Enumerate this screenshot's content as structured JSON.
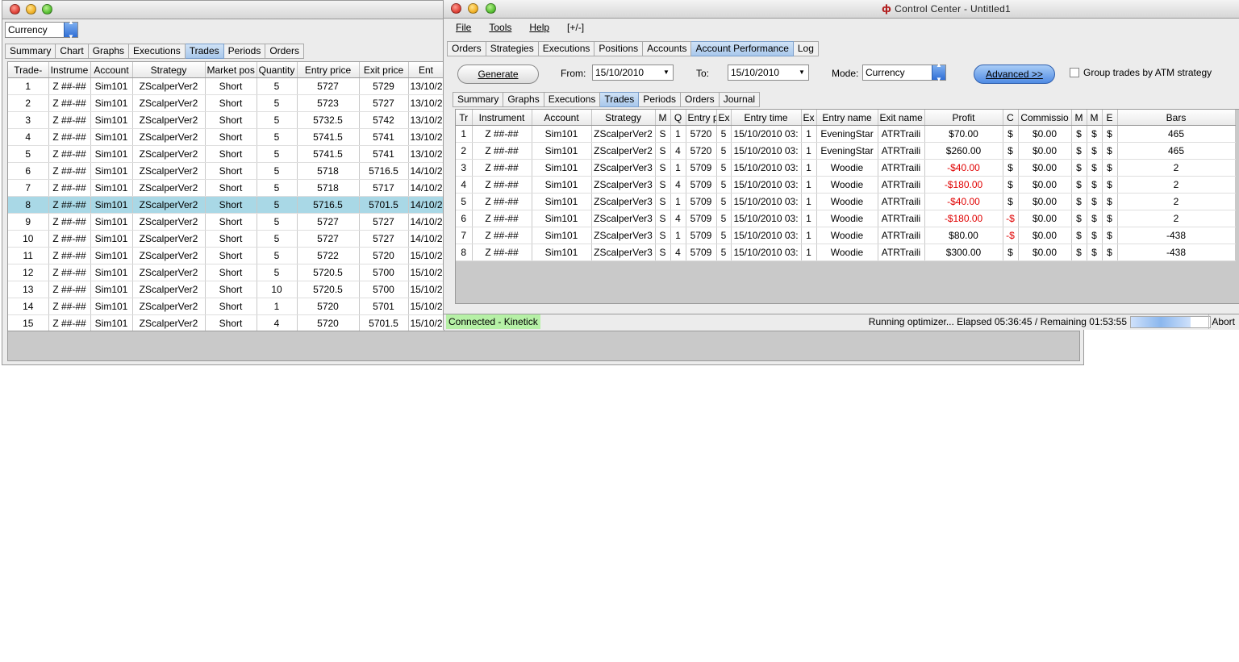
{
  "left_window": {
    "mode_value": "Currency",
    "tabs": [
      "Summary",
      "Chart",
      "Graphs",
      "Executions",
      "Trades",
      "Periods",
      "Orders"
    ],
    "active_tab": "Trades",
    "columns": [
      "Trade-",
      "Instrume",
      "Account",
      "Strategy",
      "Market pos",
      "Quantity",
      "Entry price",
      "Exit price",
      "Ent"
    ],
    "rows": [
      [
        "1",
        "Z ##-##",
        "Sim101",
        "ZScalperVer2",
        "Short",
        "5",
        "5727",
        "5729",
        "13/10/2"
      ],
      [
        "2",
        "Z ##-##",
        "Sim101",
        "ZScalperVer2",
        "Short",
        "5",
        "5723",
        "5727",
        "13/10/2"
      ],
      [
        "3",
        "Z ##-##",
        "Sim101",
        "ZScalperVer2",
        "Short",
        "5",
        "5732.5",
        "5742",
        "13/10/2"
      ],
      [
        "4",
        "Z ##-##",
        "Sim101",
        "ZScalperVer2",
        "Short",
        "5",
        "5741.5",
        "5741",
        "13/10/2"
      ],
      [
        "5",
        "Z ##-##",
        "Sim101",
        "ZScalperVer2",
        "Short",
        "5",
        "5741.5",
        "5741",
        "13/10/2"
      ],
      [
        "6",
        "Z ##-##",
        "Sim101",
        "ZScalperVer2",
        "Short",
        "5",
        "5718",
        "5716.5",
        "14/10/2"
      ],
      [
        "7",
        "Z ##-##",
        "Sim101",
        "ZScalperVer2",
        "Short",
        "5",
        "5718",
        "5717",
        "14/10/2"
      ],
      [
        "8",
        "Z ##-##",
        "Sim101",
        "ZScalperVer2",
        "Short",
        "5",
        "5716.5",
        "5701.5",
        "14/10/2"
      ],
      [
        "9",
        "Z ##-##",
        "Sim101",
        "ZScalperVer2",
        "Short",
        "5",
        "5727",
        "5727",
        "14/10/2"
      ],
      [
        "10",
        "Z ##-##",
        "Sim101",
        "ZScalperVer2",
        "Short",
        "5",
        "5727",
        "5727",
        "14/10/2"
      ],
      [
        "11",
        "Z ##-##",
        "Sim101",
        "ZScalperVer2",
        "Short",
        "5",
        "5722",
        "5720",
        "15/10/2"
      ],
      [
        "12",
        "Z ##-##",
        "Sim101",
        "ZScalperVer2",
        "Short",
        "5",
        "5720.5",
        "5700",
        "15/10/2"
      ],
      [
        "13",
        "Z ##-##",
        "Sim101",
        "ZScalperVer2",
        "Short",
        "10",
        "5720.5",
        "5700",
        "15/10/2"
      ],
      [
        "14",
        "Z ##-##",
        "Sim101",
        "ZScalperVer2",
        "Short",
        "1",
        "5720",
        "5701",
        "15/10/2"
      ],
      [
        "15",
        "Z ##-##",
        "Sim101",
        "ZScalperVer2",
        "Short",
        "4",
        "5720",
        "5701.5",
        "15/10/2"
      ]
    ],
    "selected_row": 7
  },
  "control_center": {
    "title": "Control Center - Untitled1",
    "menu": [
      "File",
      "Tools",
      "Help",
      "[+/-]"
    ],
    "main_tabs": [
      "Orders",
      "Strategies",
      "Executions",
      "Positions",
      "Accounts",
      "Account Performance",
      "Log"
    ],
    "active_main_tab": "Account Performance",
    "generate_label": "Generate",
    "from_label": "From:",
    "from_value": "15/10/2010",
    "to_label": "To:",
    "to_value": "15/10/2010",
    "mode_label": "Mode:",
    "mode_value": "Currency",
    "advanced_label": "Advanced >>",
    "group_label": "Group trades by ATM strategy",
    "sub_tabs": [
      "Summary",
      "Graphs",
      "Executions",
      "Trades",
      "Periods",
      "Orders",
      "Journal"
    ],
    "active_sub_tab": "Trades",
    "columns": [
      "Tr",
      "Instrument",
      "Account",
      "Strategy",
      "M",
      "Q",
      "Entry p",
      "Ex",
      "Entry time",
      "Ex",
      "Entry name",
      "Exit name",
      "Profit",
      "C",
      "Commissio",
      "M",
      "M",
      "E",
      "Bars"
    ],
    "rows": [
      [
        "1",
        "Z ##-##",
        "Sim101",
        "ZScalperVer2",
        "S",
        "1",
        "5720",
        "5",
        "15/10/2010 03:",
        "1",
        "EveningStar",
        "ATRTraili",
        "$70.00",
        "$",
        "$0.00",
        "$",
        "$",
        "$",
        "465"
      ],
      [
        "2",
        "Z ##-##",
        "Sim101",
        "ZScalperVer2",
        "S",
        "4",
        "5720",
        "5",
        "15/10/2010 03:",
        "1",
        "EveningStar",
        "ATRTraili",
        "$260.00",
        "$",
        "$0.00",
        "$",
        "$",
        "$",
        "465"
      ],
      [
        "3",
        "Z ##-##",
        "Sim101",
        "ZScalperVer3",
        "S",
        "1",
        "5709",
        "5",
        "15/10/2010 03:",
        "1",
        "Woodie",
        "ATRTraili",
        "-$40.00",
        "$",
        "$0.00",
        "$",
        "$",
        "$",
        "2"
      ],
      [
        "4",
        "Z ##-##",
        "Sim101",
        "ZScalperVer3",
        "S",
        "4",
        "5709",
        "5",
        "15/10/2010 03:",
        "1",
        "Woodie",
        "ATRTraili",
        "-$180.00",
        "$",
        "$0.00",
        "$",
        "$",
        "$",
        "2"
      ],
      [
        "5",
        "Z ##-##",
        "Sim101",
        "ZScalperVer3",
        "S",
        "1",
        "5709",
        "5",
        "15/10/2010 03:",
        "1",
        "Woodie",
        "ATRTraili",
        "-$40.00",
        "$",
        "$0.00",
        "$",
        "$",
        "$",
        "2"
      ],
      [
        "6",
        "Z ##-##",
        "Sim101",
        "ZScalperVer3",
        "S",
        "4",
        "5709",
        "5",
        "15/10/2010 03:",
        "1",
        "Woodie",
        "ATRTraili",
        "-$180.00",
        "-$",
        "$0.00",
        "$",
        "$",
        "$",
        "2"
      ],
      [
        "7",
        "Z ##-##",
        "Sim101",
        "ZScalperVer3",
        "S",
        "1",
        "5709",
        "5",
        "15/10/2010 03:",
        "1",
        "Woodie",
        "ATRTraili",
        "$80.00",
        "-$",
        "$0.00",
        "$",
        "$",
        "$",
        "-438"
      ],
      [
        "8",
        "Z ##-##",
        "Sim101",
        "ZScalperVer3",
        "S",
        "4",
        "5709",
        "5",
        "15/10/2010 03:",
        "1",
        "Woodie",
        "ATRTraili",
        "$300.00",
        "$",
        "$0.00",
        "$",
        "$",
        "$",
        "-438"
      ]
    ],
    "status_connected": "Connected - Kinetick",
    "status_progress_text": "Running optimizer... Elapsed 05:36:45 / Remaining 01:53:55",
    "abort_label": "Abort",
    "progress_fraction": 0.75
  }
}
